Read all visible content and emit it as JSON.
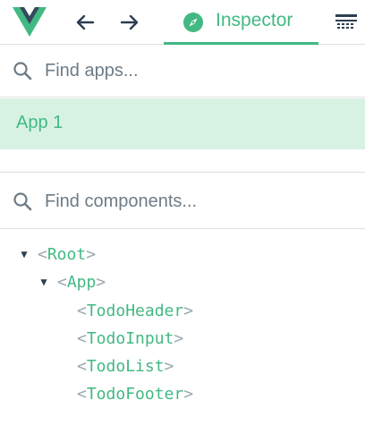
{
  "toolbar": {
    "logo": "vue-logo",
    "back_icon": "arrow-left-icon",
    "forward_icon": "arrow-right-icon",
    "active_tab": {
      "label": "Inspector",
      "icon": "compass-icon"
    },
    "more_icon": "menu-table-icon"
  },
  "apps": {
    "search_placeholder": "Find apps...",
    "items": [
      {
        "label": "App 1",
        "selected": true
      }
    ]
  },
  "components": {
    "search_placeholder": "Find components...",
    "tree": [
      {
        "name": "Root",
        "expanded": true,
        "depth": 0
      },
      {
        "name": "App",
        "expanded": true,
        "depth": 1
      },
      {
        "name": "TodoHeader",
        "depth": 2
      },
      {
        "name": "TodoInput",
        "depth": 2
      },
      {
        "name": "TodoList",
        "depth": 2
      },
      {
        "name": "TodoFooter",
        "depth": 2
      }
    ]
  },
  "colors": {
    "accent": "#42b983",
    "selected_bg": "#d7f2e3",
    "text": "#2c3e50",
    "bracket": "#9aa7b1"
  }
}
